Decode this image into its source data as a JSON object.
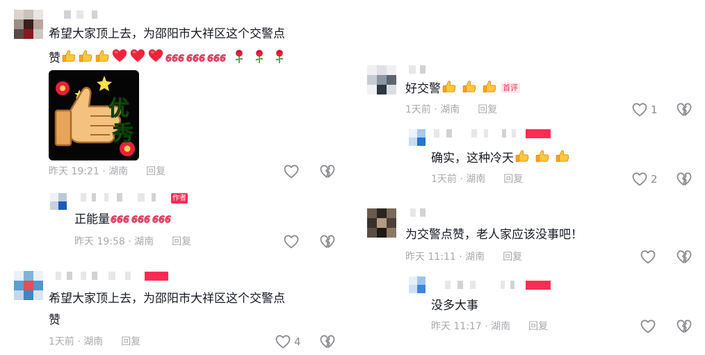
{
  "left": {
    "c1": {
      "text_line1": "希望大家顶上去，为邵阳市大祥区这个交警点",
      "text_line2": "赞",
      "emojis": [
        "thumbs-up",
        "thumbs-up",
        "thumbs-up",
        "red-heart",
        "red-heart",
        "red-heart",
        "666",
        "666",
        "666",
        "rose",
        "rose",
        "rose"
      ],
      "sticker_text_1": "优",
      "sticker_text_2": "秀",
      "time": "昨天 19:21 · 湖南",
      "reply": "回复",
      "likes": ""
    },
    "r1": {
      "author_tag": "作者",
      "text": "正能量",
      "emojis": [
        "666",
        "666",
        "666"
      ],
      "time": "昨天 19:58 · 湖南",
      "reply": "回复",
      "likes": ""
    },
    "c2": {
      "text_line1": "希望大家顶上去，为邵阳市大祥区这个交警点",
      "text_line2": "赞",
      "time": "1天前 · 湖南",
      "reply": "回复",
      "likes": "4"
    }
  },
  "right": {
    "c1": {
      "text": "好交警",
      "emojis": [
        "thumbs-up",
        "thumbs-up",
        "thumbs-up"
      ],
      "tag": "首评",
      "time": "1天前 · 湖南",
      "reply": "回复",
      "likes": "1"
    },
    "r1": {
      "text": "确实，这种冷天",
      "emojis": [
        "thumbs-up",
        "thumbs-up",
        "thumbs-up"
      ],
      "time": "1天前 · 湖南",
      "reply": "回复",
      "likes": "2"
    },
    "c2": {
      "text": "为交警点赞，老人家应该没事吧！",
      "time": "昨天 11:11 · 湖南",
      "reply": "回复",
      "likes": ""
    },
    "r2": {
      "text": "没多大事",
      "time": "昨天 11:17 · 湖南",
      "reply": "回复",
      "likes": ""
    }
  },
  "colors": {
    "accent": "#fe2c55",
    "meta_text": "#a8a9ae",
    "body_text": "#161823",
    "icon": "#8a8b91"
  }
}
